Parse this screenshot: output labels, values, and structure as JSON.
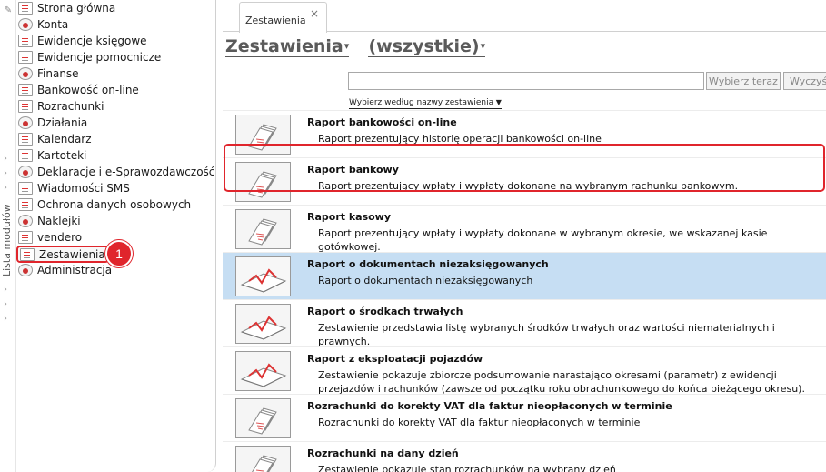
{
  "rail": {
    "label": "Lista modułów"
  },
  "modules": [
    {
      "label": "Strona główna",
      "icon": "home-icon"
    },
    {
      "label": "Konta",
      "icon": "accounts-icon"
    },
    {
      "label": "Ewidencje księgowe",
      "icon": "ledger-icon"
    },
    {
      "label": "Ewidencje pomocnicze",
      "icon": "aux-ledger-icon"
    },
    {
      "label": "Finanse",
      "icon": "finance-icon"
    },
    {
      "label": "Bankowość on-line",
      "icon": "bank-icon"
    },
    {
      "label": "Rozrachunki",
      "icon": "settlements-icon"
    },
    {
      "label": "Działania",
      "icon": "actions-icon"
    },
    {
      "label": "Kalendarz",
      "icon": "calendar-icon"
    },
    {
      "label": "Kartoteki",
      "icon": "files-icon"
    },
    {
      "label": "Deklaracje i e-Sprawozdawczość",
      "icon": "declarations-icon"
    },
    {
      "label": "Wiadomości SMS",
      "icon": "sms-icon"
    },
    {
      "label": "Ochrona danych osobowych",
      "icon": "privacy-icon"
    },
    {
      "label": "Naklejki",
      "icon": "labels-icon"
    },
    {
      "label": "vendero",
      "icon": "vendero-icon"
    },
    {
      "label": "Zestawienia",
      "icon": "reports-icon"
    },
    {
      "label": "Administracja",
      "icon": "admin-icon"
    }
  ],
  "badge": "1",
  "tab": {
    "label": "Zestawienia",
    "close": "×"
  },
  "title": {
    "primary": "Zestawienia",
    "secondary": "(wszystkie)",
    "caret": "▾"
  },
  "search": {
    "value": "",
    "choose_label": "Wybierz teraz",
    "clear_label": "Wyczyść"
  },
  "filter_by": "Wybierz według nazwy zestawienia",
  "reports": [
    {
      "title": "Raport bankowości on-line",
      "desc": "Raport prezentujący historię operacji bankowości on-line",
      "icon": "pages-icon"
    },
    {
      "title": "Raport bankowy",
      "desc": "Raport prezentujący wpłaty i wypłaty dokonane na wybranym rachunku bankowym.",
      "icon": "pages-icon"
    },
    {
      "title": "Raport kasowy",
      "desc": "Raport prezentujący wpłaty i wypłaty dokonane w wybranym okresie, we wskazanej kasie gotówkowej.",
      "icon": "pages-icon"
    },
    {
      "title": "Raport o dokumentach niezaksięgowanych",
      "desc": "Raport o dokumentach niezaksięgowanych",
      "icon": "chart-page-icon"
    },
    {
      "title": "Raport o środkach trwałych",
      "desc": "Zestawienie przedstawia listę wybranych środków trwałych oraz wartości niematerialnych i prawnych.",
      "icon": "chart-page-icon"
    },
    {
      "title": "Raport z eksploatacji pojazdów",
      "desc": "Zestawienie pokazuje zbiorcze podsumowanie narastająco okresami (parametr) z ewidencji przejazdów i rachunków (zawsze od początku roku obrachunkowego do końca bieżącego okresu).",
      "icon": "chart-page-icon"
    },
    {
      "title": "Rozrachunki do korekty VAT dla faktur nieopłaconych w terminie",
      "desc": "Rozrachunki do korekty VAT dla faktur nieopłaconych w terminie",
      "icon": "pages-icon"
    },
    {
      "title": "Rozrachunki na dany dzień",
      "desc": "Zestawienie pokazuje stan rozrachunków na wybrany dzień",
      "icon": "pages-icon"
    }
  ],
  "selected_index": 3,
  "colors": {
    "accent_red": "#e0252c",
    "selection": "#c6def3"
  }
}
